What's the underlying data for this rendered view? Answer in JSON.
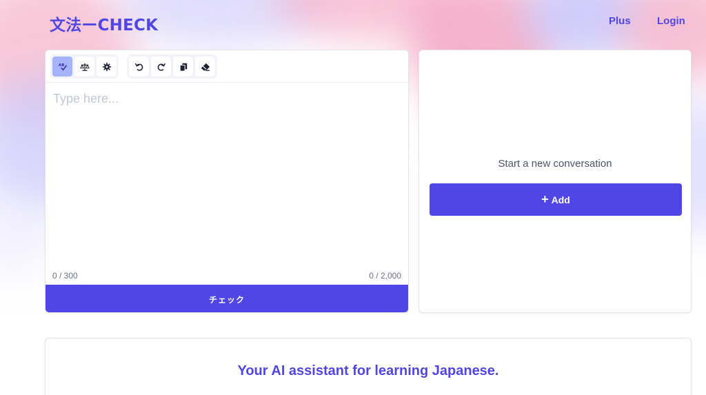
{
  "header": {
    "logo": "文法ーCHECK",
    "nav": {
      "plus": "Plus",
      "login": "Login"
    }
  },
  "editor": {
    "toolbar": {
      "group1": [
        {
          "icon": "spell-check-icon",
          "active": true
        },
        {
          "icon": "balance-scale-icon",
          "active": false
        },
        {
          "icon": "settings-gear-icon",
          "active": false
        }
      ],
      "group2": [
        {
          "icon": "undo-icon"
        },
        {
          "icon": "redo-icon"
        },
        {
          "icon": "copy-icon"
        },
        {
          "icon": "eraser-icon"
        }
      ]
    },
    "placeholder": "Type here...",
    "value": "",
    "char_count": "0 / 300",
    "total_count": "0 / 2,000",
    "check_button": "チェック"
  },
  "chat": {
    "start_text": "Start a new conversation",
    "add_button": "Add",
    "add_icon": "+"
  },
  "info": {
    "tagline": "Your AI assistant for learning Japanese."
  },
  "colors": {
    "accent": "#4f46e5",
    "active_tool": "#a5b4fc",
    "placeholder": "#c3c8d1"
  }
}
